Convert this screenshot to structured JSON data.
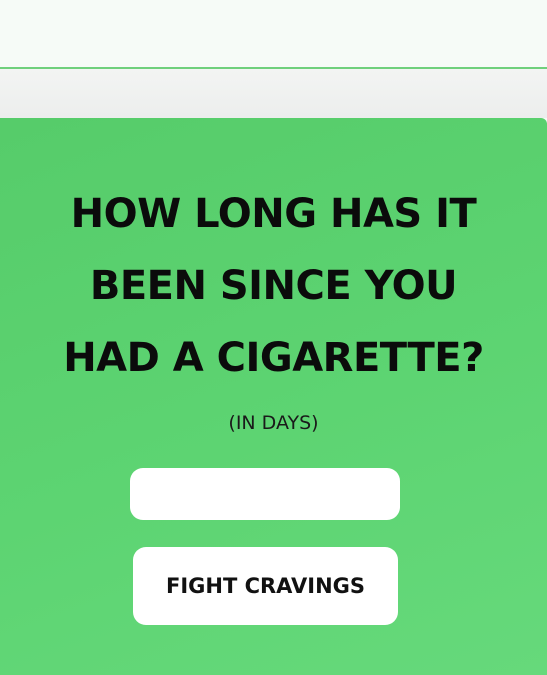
{
  "question": {
    "lines": [
      "HOW LONG HAS IT",
      "BEEN SINCE YOU",
      "HAD A CIGARETTE?"
    ]
  },
  "units_label": "(IN DAYS)",
  "days_input": {
    "value": "",
    "placeholder": ""
  },
  "cta": {
    "label": "FIGHT CRAVINGS"
  },
  "colors": {
    "card_background": "#5dd472",
    "accent_line": "#6fd07c",
    "text": "#0b0b0b"
  }
}
